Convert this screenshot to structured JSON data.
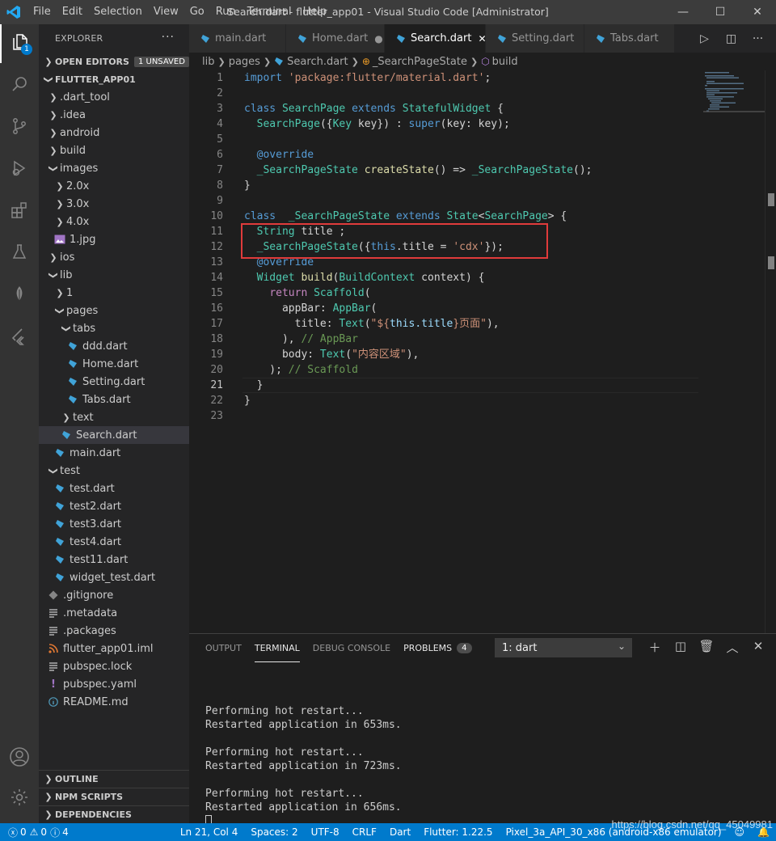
{
  "titlebar": {
    "menu": [
      "File",
      "Edit",
      "Selection",
      "View",
      "Go",
      "Run",
      "Terminal",
      "Help"
    ],
    "window_title": "Search.dart - flutter_app01 - Visual Studio Code [Administrator]",
    "minimize": "—",
    "maximize": "☐",
    "close": "✕"
  },
  "activity": {
    "explorer_badge": "1"
  },
  "sidebar": {
    "title": "EXPLORER",
    "more": "···",
    "open_editors": "OPEN EDITORS",
    "unsaved_badge": "1 UNSAVED",
    "project": "FLUTTER_APP01",
    "tree": [
      {
        "label": ".dart_tool",
        "indent": 1,
        "type": "folder",
        "open": false
      },
      {
        "label": ".idea",
        "indent": 1,
        "type": "folder",
        "open": false
      },
      {
        "label": "android",
        "indent": 1,
        "type": "folder",
        "open": false
      },
      {
        "label": "build",
        "indent": 1,
        "type": "folder",
        "open": false
      },
      {
        "label": "images",
        "indent": 1,
        "type": "folder",
        "open": true
      },
      {
        "label": "2.0x",
        "indent": 2,
        "type": "folder",
        "open": false
      },
      {
        "label": "3.0x",
        "indent": 2,
        "type": "folder",
        "open": false
      },
      {
        "label": "4.0x",
        "indent": 2,
        "type": "folder",
        "open": false
      },
      {
        "label": "1.jpg",
        "indent": 2,
        "type": "image"
      },
      {
        "label": "ios",
        "indent": 1,
        "type": "folder",
        "open": false
      },
      {
        "label": "lib",
        "indent": 1,
        "type": "folder",
        "open": true
      },
      {
        "label": "1",
        "indent": 2,
        "type": "folder",
        "open": false
      },
      {
        "label": "pages",
        "indent": 2,
        "type": "folder",
        "open": true
      },
      {
        "label": "tabs",
        "indent": 3,
        "type": "folder",
        "open": true
      },
      {
        "label": "ddd.dart",
        "indent": 4,
        "type": "dart"
      },
      {
        "label": "Home.dart",
        "indent": 4,
        "type": "dart"
      },
      {
        "label": "Setting.dart",
        "indent": 4,
        "type": "dart"
      },
      {
        "label": "Tabs.dart",
        "indent": 4,
        "type": "dart"
      },
      {
        "label": "text",
        "indent": 3,
        "type": "folder",
        "open": false
      },
      {
        "label": "Search.dart",
        "indent": 3,
        "type": "dart",
        "selected": true
      },
      {
        "label": "main.dart",
        "indent": 2,
        "type": "dart"
      },
      {
        "label": "test",
        "indent": 1,
        "type": "folder",
        "open": true
      },
      {
        "label": "test.dart",
        "indent": 2,
        "type": "dart"
      },
      {
        "label": "test2.dart",
        "indent": 2,
        "type": "dart"
      },
      {
        "label": "test3.dart",
        "indent": 2,
        "type": "dart"
      },
      {
        "label": "test4.dart",
        "indent": 2,
        "type": "dart"
      },
      {
        "label": "test11.dart",
        "indent": 2,
        "type": "dart"
      },
      {
        "label": "widget_test.dart",
        "indent": 2,
        "type": "dart"
      },
      {
        "label": ".gitignore",
        "indent": 1,
        "type": "git"
      },
      {
        "label": ".metadata",
        "indent": 1,
        "type": "lines"
      },
      {
        "label": ".packages",
        "indent": 1,
        "type": "lines"
      },
      {
        "label": "flutter_app01.iml",
        "indent": 1,
        "type": "rss"
      },
      {
        "label": "pubspec.lock",
        "indent": 1,
        "type": "lines"
      },
      {
        "label": "pubspec.yaml",
        "indent": 1,
        "type": "yaml"
      },
      {
        "label": "README.md",
        "indent": 1,
        "type": "info"
      }
    ],
    "bottom_sections": [
      "OUTLINE",
      "NPM SCRIPTS",
      "DEPENDENCIES"
    ]
  },
  "tabs": [
    {
      "label": "main.dart",
      "state": ""
    },
    {
      "label": "Home.dart",
      "state": "●"
    },
    {
      "label": "Search.dart",
      "state": "✕",
      "active": true
    },
    {
      "label": "Setting.dart",
      "state": ""
    },
    {
      "label": "Tabs.dart",
      "state": ""
    }
  ],
  "breadcrumb": {
    "part1": "lib",
    "part2": "pages",
    "part3": "Search.dart",
    "part4": "_SearchPageState",
    "part5": "build"
  },
  "code": {
    "lines": [
      [
        [
          "k",
          "import"
        ],
        [
          "p",
          " "
        ],
        [
          "s",
          "'package:flutter/material.dart'"
        ],
        [
          "p",
          ";"
        ]
      ],
      [],
      [
        [
          "k",
          "class"
        ],
        [
          "p",
          " "
        ],
        [
          "t",
          "SearchPage"
        ],
        [
          "p",
          " "
        ],
        [
          "k",
          "extends"
        ],
        [
          "p",
          " "
        ],
        [
          "t",
          "StatefulWidget"
        ],
        [
          "p",
          " {"
        ]
      ],
      [
        [
          "p",
          "  "
        ],
        [
          "t",
          "SearchPage"
        ],
        [
          "p",
          "({"
        ],
        [
          "t",
          "Key"
        ],
        [
          "p",
          " key}) : "
        ],
        [
          "k",
          "super"
        ],
        [
          "p",
          "(key: key);"
        ]
      ],
      [],
      [
        [
          "p",
          "  "
        ],
        [
          "k",
          "@override"
        ]
      ],
      [
        [
          "p",
          "  "
        ],
        [
          "t",
          "_SearchPageState"
        ],
        [
          "p",
          " "
        ],
        [
          "f",
          "createState"
        ],
        [
          "p",
          "() => "
        ],
        [
          "t",
          "_SearchPageState"
        ],
        [
          "p",
          "();"
        ]
      ],
      [
        [
          "p",
          "}"
        ]
      ],
      [],
      [
        [
          "k",
          "class"
        ],
        [
          "p",
          "  "
        ],
        [
          "t",
          "_SearchPageState"
        ],
        [
          "p",
          " "
        ],
        [
          "k",
          "extends"
        ],
        [
          "p",
          " "
        ],
        [
          "t",
          "State"
        ],
        [
          "p",
          "<"
        ],
        [
          "t",
          "SearchPage"
        ],
        [
          "p",
          "> {"
        ]
      ],
      [
        [
          "p",
          "  "
        ],
        [
          "t",
          "String"
        ],
        [
          "p",
          " title ;"
        ]
      ],
      [
        [
          "p",
          "  "
        ],
        [
          "t",
          "_SearchPageState"
        ],
        [
          "p",
          "({"
        ],
        [
          "k",
          "this"
        ],
        [
          "p",
          ".title = "
        ],
        [
          "s",
          "'cdx'"
        ],
        [
          "p",
          "});"
        ]
      ],
      [
        [
          "p",
          "  "
        ],
        [
          "k",
          "@override"
        ]
      ],
      [
        [
          "p",
          "  "
        ],
        [
          "t",
          "Widget"
        ],
        [
          "p",
          " "
        ],
        [
          "f",
          "build"
        ],
        [
          "p",
          "("
        ],
        [
          "t",
          "BuildContext"
        ],
        [
          "p",
          " context) {"
        ]
      ],
      [
        [
          "p",
          "    "
        ],
        [
          "c",
          "return"
        ],
        [
          "p",
          " "
        ],
        [
          "t",
          "Scaffold"
        ],
        [
          "p",
          "("
        ]
      ],
      [
        [
          "p",
          "      appBar: "
        ],
        [
          "t",
          "AppBar"
        ],
        [
          "p",
          "("
        ]
      ],
      [
        [
          "p",
          "        title: "
        ],
        [
          "t",
          "Text"
        ],
        [
          "p",
          "("
        ],
        [
          "s",
          "\"${"
        ],
        [
          "v",
          "this.title"
        ],
        [
          "s",
          "}页面\""
        ],
        [
          "p",
          "),"
        ]
      ],
      [
        [
          "p",
          "      ), "
        ],
        [
          "cm",
          "// AppBar"
        ]
      ],
      [
        [
          "p",
          "      body: "
        ],
        [
          "t",
          "Text"
        ],
        [
          "p",
          "("
        ],
        [
          "s",
          "\"内容区域\""
        ],
        [
          "p",
          "),"
        ]
      ],
      [
        [
          "p",
          "    ); "
        ],
        [
          "cm",
          "// Scaffold"
        ]
      ],
      [
        [
          "p",
          "  }"
        ]
      ],
      [
        [
          "p",
          "}"
        ]
      ],
      []
    ]
  },
  "panel": {
    "tabs": [
      "OUTPUT",
      "TERMINAL",
      "DEBUG CONSOLE",
      "PROBLEMS"
    ],
    "active_tab": "TERMINAL",
    "problems_count": "4",
    "terminal_select": "1: dart",
    "terminal_lines": [
      "",
      "Performing hot restart...",
      "Restarted application in 653ms.",
      "",
      "Performing hot restart...",
      "Restarted application in 723ms.",
      "",
      "Performing hot restart...",
      "Restarted application in 656ms."
    ]
  },
  "statusbar": {
    "errors": "0",
    "warnings": "0",
    "info": "4",
    "position": "Ln 21, Col 4",
    "spaces": "Spaces: 2",
    "encoding": "UTF-8",
    "eol": "CRLF",
    "language": "Dart",
    "flutter": "Flutter: 1.22.5",
    "device": "Pixel_3a_API_30_x86 (android-x86 emulator)"
  },
  "watermark": "https://blog.csdn.net/qq_45049981",
  "colors": {
    "accent": "#007acc",
    "highlight_box": "#e03b3b"
  }
}
